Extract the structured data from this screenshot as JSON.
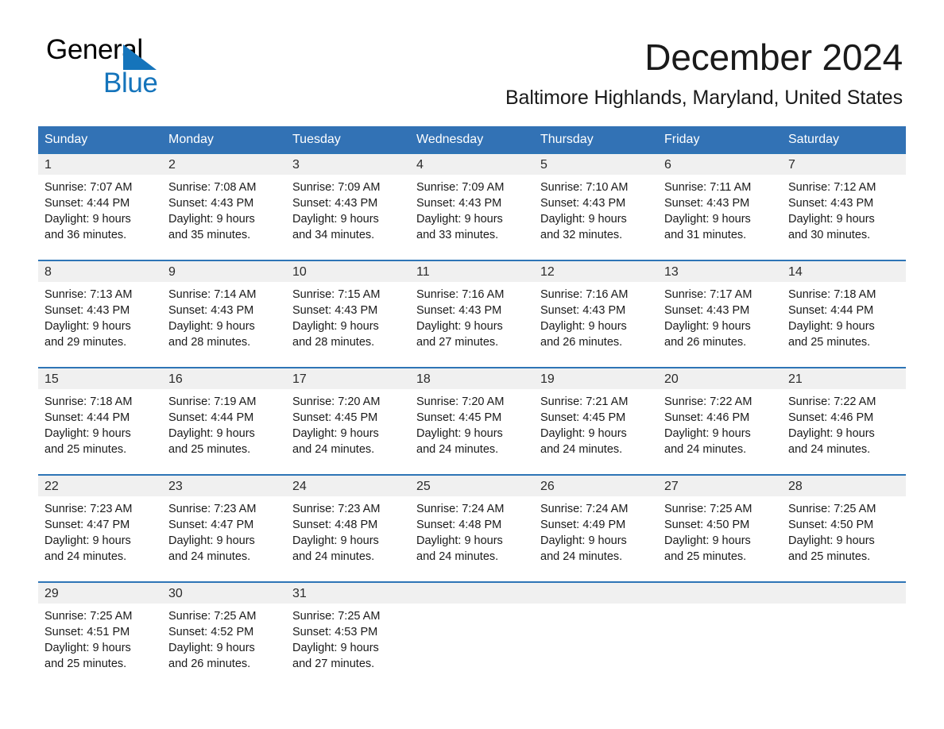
{
  "brand": {
    "name_part1": "General",
    "name_part2": "Blue",
    "triangle_icon": "triangle-icon",
    "accent_color": "#1574bb"
  },
  "header": {
    "title": "December 2024",
    "location": "Baltimore Highlands, Maryland, United States"
  },
  "theme": {
    "header_blue": "#3272b5",
    "row_divider_blue": "#2e75b6",
    "daynum_band": "#f0f0f0",
    "text": "#1a1a1a"
  },
  "weekday_headers": [
    "Sunday",
    "Monday",
    "Tuesday",
    "Wednesday",
    "Thursday",
    "Friday",
    "Saturday"
  ],
  "weeks": [
    [
      {
        "day": "1",
        "sunrise": "Sunrise: 7:07 AM",
        "sunset": "Sunset: 4:44 PM",
        "daylight_line1": "Daylight: 9 hours",
        "daylight_line2": "and 36 minutes."
      },
      {
        "day": "2",
        "sunrise": "Sunrise: 7:08 AM",
        "sunset": "Sunset: 4:43 PM",
        "daylight_line1": "Daylight: 9 hours",
        "daylight_line2": "and 35 minutes."
      },
      {
        "day": "3",
        "sunrise": "Sunrise: 7:09 AM",
        "sunset": "Sunset: 4:43 PM",
        "daylight_line1": "Daylight: 9 hours",
        "daylight_line2": "and 34 minutes."
      },
      {
        "day": "4",
        "sunrise": "Sunrise: 7:09 AM",
        "sunset": "Sunset: 4:43 PM",
        "daylight_line1": "Daylight: 9 hours",
        "daylight_line2": "and 33 minutes."
      },
      {
        "day": "5",
        "sunrise": "Sunrise: 7:10 AM",
        "sunset": "Sunset: 4:43 PM",
        "daylight_line1": "Daylight: 9 hours",
        "daylight_line2": "and 32 minutes."
      },
      {
        "day": "6",
        "sunrise": "Sunrise: 7:11 AM",
        "sunset": "Sunset: 4:43 PM",
        "daylight_line1": "Daylight: 9 hours",
        "daylight_line2": "and 31 minutes."
      },
      {
        "day": "7",
        "sunrise": "Sunrise: 7:12 AM",
        "sunset": "Sunset: 4:43 PM",
        "daylight_line1": "Daylight: 9 hours",
        "daylight_line2": "and 30 minutes."
      }
    ],
    [
      {
        "day": "8",
        "sunrise": "Sunrise: 7:13 AM",
        "sunset": "Sunset: 4:43 PM",
        "daylight_line1": "Daylight: 9 hours",
        "daylight_line2": "and 29 minutes."
      },
      {
        "day": "9",
        "sunrise": "Sunrise: 7:14 AM",
        "sunset": "Sunset: 4:43 PM",
        "daylight_line1": "Daylight: 9 hours",
        "daylight_line2": "and 28 minutes."
      },
      {
        "day": "10",
        "sunrise": "Sunrise: 7:15 AM",
        "sunset": "Sunset: 4:43 PM",
        "daylight_line1": "Daylight: 9 hours",
        "daylight_line2": "and 28 minutes."
      },
      {
        "day": "11",
        "sunrise": "Sunrise: 7:16 AM",
        "sunset": "Sunset: 4:43 PM",
        "daylight_line1": "Daylight: 9 hours",
        "daylight_line2": "and 27 minutes."
      },
      {
        "day": "12",
        "sunrise": "Sunrise: 7:16 AM",
        "sunset": "Sunset: 4:43 PM",
        "daylight_line1": "Daylight: 9 hours",
        "daylight_line2": "and 26 minutes."
      },
      {
        "day": "13",
        "sunrise": "Sunrise: 7:17 AM",
        "sunset": "Sunset: 4:43 PM",
        "daylight_line1": "Daylight: 9 hours",
        "daylight_line2": "and 26 minutes."
      },
      {
        "day": "14",
        "sunrise": "Sunrise: 7:18 AM",
        "sunset": "Sunset: 4:44 PM",
        "daylight_line1": "Daylight: 9 hours",
        "daylight_line2": "and 25 minutes."
      }
    ],
    [
      {
        "day": "15",
        "sunrise": "Sunrise: 7:18 AM",
        "sunset": "Sunset: 4:44 PM",
        "daylight_line1": "Daylight: 9 hours",
        "daylight_line2": "and 25 minutes."
      },
      {
        "day": "16",
        "sunrise": "Sunrise: 7:19 AM",
        "sunset": "Sunset: 4:44 PM",
        "daylight_line1": "Daylight: 9 hours",
        "daylight_line2": "and 25 minutes."
      },
      {
        "day": "17",
        "sunrise": "Sunrise: 7:20 AM",
        "sunset": "Sunset: 4:45 PM",
        "daylight_line1": "Daylight: 9 hours",
        "daylight_line2": "and 24 minutes."
      },
      {
        "day": "18",
        "sunrise": "Sunrise: 7:20 AM",
        "sunset": "Sunset: 4:45 PM",
        "daylight_line1": "Daylight: 9 hours",
        "daylight_line2": "and 24 minutes."
      },
      {
        "day": "19",
        "sunrise": "Sunrise: 7:21 AM",
        "sunset": "Sunset: 4:45 PM",
        "daylight_line1": "Daylight: 9 hours",
        "daylight_line2": "and 24 minutes."
      },
      {
        "day": "20",
        "sunrise": "Sunrise: 7:22 AM",
        "sunset": "Sunset: 4:46 PM",
        "daylight_line1": "Daylight: 9 hours",
        "daylight_line2": "and 24 minutes."
      },
      {
        "day": "21",
        "sunrise": "Sunrise: 7:22 AM",
        "sunset": "Sunset: 4:46 PM",
        "daylight_line1": "Daylight: 9 hours",
        "daylight_line2": "and 24 minutes."
      }
    ],
    [
      {
        "day": "22",
        "sunrise": "Sunrise: 7:23 AM",
        "sunset": "Sunset: 4:47 PM",
        "daylight_line1": "Daylight: 9 hours",
        "daylight_line2": "and 24 minutes."
      },
      {
        "day": "23",
        "sunrise": "Sunrise: 7:23 AM",
        "sunset": "Sunset: 4:47 PM",
        "daylight_line1": "Daylight: 9 hours",
        "daylight_line2": "and 24 minutes."
      },
      {
        "day": "24",
        "sunrise": "Sunrise: 7:23 AM",
        "sunset": "Sunset: 4:48 PM",
        "daylight_line1": "Daylight: 9 hours",
        "daylight_line2": "and 24 minutes."
      },
      {
        "day": "25",
        "sunrise": "Sunrise: 7:24 AM",
        "sunset": "Sunset: 4:48 PM",
        "daylight_line1": "Daylight: 9 hours",
        "daylight_line2": "and 24 minutes."
      },
      {
        "day": "26",
        "sunrise": "Sunrise: 7:24 AM",
        "sunset": "Sunset: 4:49 PM",
        "daylight_line1": "Daylight: 9 hours",
        "daylight_line2": "and 24 minutes."
      },
      {
        "day": "27",
        "sunrise": "Sunrise: 7:25 AM",
        "sunset": "Sunset: 4:50 PM",
        "daylight_line1": "Daylight: 9 hours",
        "daylight_line2": "and 25 minutes."
      },
      {
        "day": "28",
        "sunrise": "Sunrise: 7:25 AM",
        "sunset": "Sunset: 4:50 PM",
        "daylight_line1": "Daylight: 9 hours",
        "daylight_line2": "and 25 minutes."
      }
    ],
    [
      {
        "day": "29",
        "sunrise": "Sunrise: 7:25 AM",
        "sunset": "Sunset: 4:51 PM",
        "daylight_line1": "Daylight: 9 hours",
        "daylight_line2": "and 25 minutes."
      },
      {
        "day": "30",
        "sunrise": "Sunrise: 7:25 AM",
        "sunset": "Sunset: 4:52 PM",
        "daylight_line1": "Daylight: 9 hours",
        "daylight_line2": "and 26 minutes."
      },
      {
        "day": "31",
        "sunrise": "Sunrise: 7:25 AM",
        "sunset": "Sunset: 4:53 PM",
        "daylight_line1": "Daylight: 9 hours",
        "daylight_line2": "and 27 minutes."
      },
      {
        "day": "",
        "sunrise": "",
        "sunset": "",
        "daylight_line1": "",
        "daylight_line2": ""
      },
      {
        "day": "",
        "sunrise": "",
        "sunset": "",
        "daylight_line1": "",
        "daylight_line2": ""
      },
      {
        "day": "",
        "sunrise": "",
        "sunset": "",
        "daylight_line1": "",
        "daylight_line2": ""
      },
      {
        "day": "",
        "sunrise": "",
        "sunset": "",
        "daylight_line1": "",
        "daylight_line2": ""
      }
    ]
  ]
}
